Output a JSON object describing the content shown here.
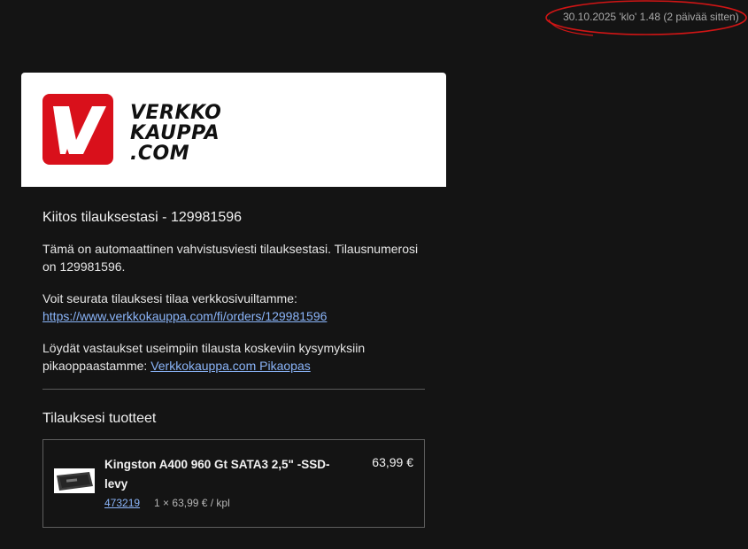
{
  "header": {
    "timestamp": "30.10.2025 'klo' 1.48 (2 päivää sitten)"
  },
  "logo": {
    "line1": "VERKKO",
    "line2": "KAUPPA",
    "line3": ".COM",
    "brand_color": "#d9101b"
  },
  "email": {
    "title": "Kiitos tilauksestasi - 129981596",
    "intro_line1": "Tämä on automaattinen vahvistusviesti tilauksestasi. Tilausnumerosi",
    "intro_line2": "on 129981596.",
    "track_text": "Voit seurata tilauksesi tilaa verkkosivuiltamme:",
    "track_link": "https://www.verkkokauppa.com/fi/orders/129981596",
    "faq_line1": "Löydät vastaukset useimpiin tilausta koskeviin kysymyksiin",
    "faq_prefix": "pikaoppaastamme: ",
    "faq_link": "Verkkokauppa.com Pikaopas",
    "products_title": "Tilauksesi tuotteet"
  },
  "products": [
    {
      "name_line1": "Kingston A400 960 Gt SATA3 2,5\" -SSD-",
      "name_line2": "levy",
      "price": "63,99 €",
      "sku": "473219",
      "quantity": "1 × 63,99 € / kpl"
    }
  ],
  "colors": {
    "background": "#141414",
    "link": "#8ab4f8",
    "annotation": "#d01515"
  }
}
